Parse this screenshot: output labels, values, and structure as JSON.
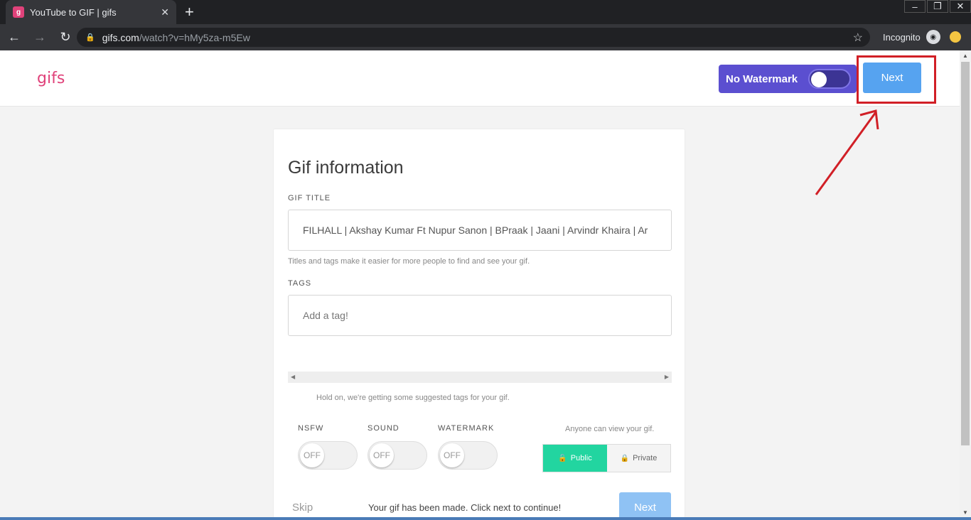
{
  "browser": {
    "tab_title": "YouTube to GIF | gifs",
    "tab_favicon_letter": "g",
    "url_domain": "gifs.com",
    "url_path": "/watch?v=hMy5za-m5Ew",
    "incognito_label": "Incognito",
    "window_controls": [
      "–",
      "❐",
      "✕"
    ]
  },
  "app": {
    "logo": "gifs",
    "watermark_toggle_label": "No Watermark",
    "next_label": "Next"
  },
  "card": {
    "heading": "Gif information",
    "gif_title_label": "GIF TITLE",
    "gif_title_value": "FILHALL | Akshay Kumar Ft Nupur Sanon | BPraak | Jaani | Arvindr Khaira | Ar",
    "titles_hint": "Titles and tags make it easier for more people to find and see your gif.",
    "tags_label": "TAGS",
    "tags_placeholder": "Add a tag!",
    "suggest_hint": "Hold on, we're getting some suggested tags for your gif.",
    "toggles": [
      {
        "label": "NSFW",
        "state": "OFF"
      },
      {
        "label": "SOUND",
        "state": "OFF"
      },
      {
        "label": "WATERMARK",
        "state": "OFF"
      }
    ],
    "visibility_hint": "Anyone can view your gif.",
    "public_label": "Public",
    "private_label": "Private",
    "skip_label": "Skip",
    "made_message": "Your gif has been made. Click next to continue!",
    "next_label": "Next"
  },
  "colors": {
    "brand": "#e0427a",
    "watermark_bg": "#5b4fd0",
    "next_blue": "#56a3f0",
    "public_green": "#22d5a0",
    "highlight_red": "#d11f26"
  }
}
